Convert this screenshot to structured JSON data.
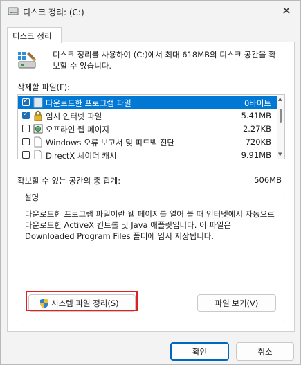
{
  "window": {
    "title": "디스크 정리: (C:)",
    "close_glyph": "✕"
  },
  "tab": {
    "label": "디스크 정리"
  },
  "intro": {
    "text": "디스크 정리를 사용하여 (C:)에서 최대 618MB의 디스크 공간을 확보할 수 있습니다."
  },
  "files": {
    "label": "삭제할 파일(F):",
    "items": [
      {
        "name": "다운로드한 프로그램 파일",
        "size": "0바이트",
        "checked": true,
        "selected": true,
        "icon": "folder-icon"
      },
      {
        "name": "임시 인터넷 파일",
        "size": "5.41MB",
        "checked": true,
        "selected": false,
        "icon": "lock-icon"
      },
      {
        "name": "오프라인 웹 페이지",
        "size": "2.27KB",
        "checked": false,
        "selected": false,
        "icon": "offline-page-icon"
      },
      {
        "name": "Windows 오류 보고서 및 피드백 진단",
        "size": "720KB",
        "checked": false,
        "selected": false,
        "icon": "document-icon"
      },
      {
        "name": "DirectX 셰이더 캐시",
        "size": "9.91MB",
        "checked": false,
        "selected": false,
        "icon": "document-icon"
      }
    ]
  },
  "total": {
    "label": "확보할 수 있는 공간의 총 합계:",
    "value": "506MB"
  },
  "description": {
    "title": "설명",
    "text": "다운로드한 프로그램 파일이란 웹 페이지를 열어 볼 때 인터넷에서 자동으로 다운로드한 ActiveX 컨트롤 및 Java 애플릿입니다. 이 파일은 Downloaded Program Files 폴더에 임시 저장됩니다."
  },
  "buttons": {
    "system_cleanup": "시스템 파일 정리(S)",
    "view_files": "파일 보기(V)",
    "ok": "확인",
    "cancel": "취소"
  },
  "colors": {
    "accent": "#0078d4",
    "highlight_frame": "#e0201e"
  }
}
